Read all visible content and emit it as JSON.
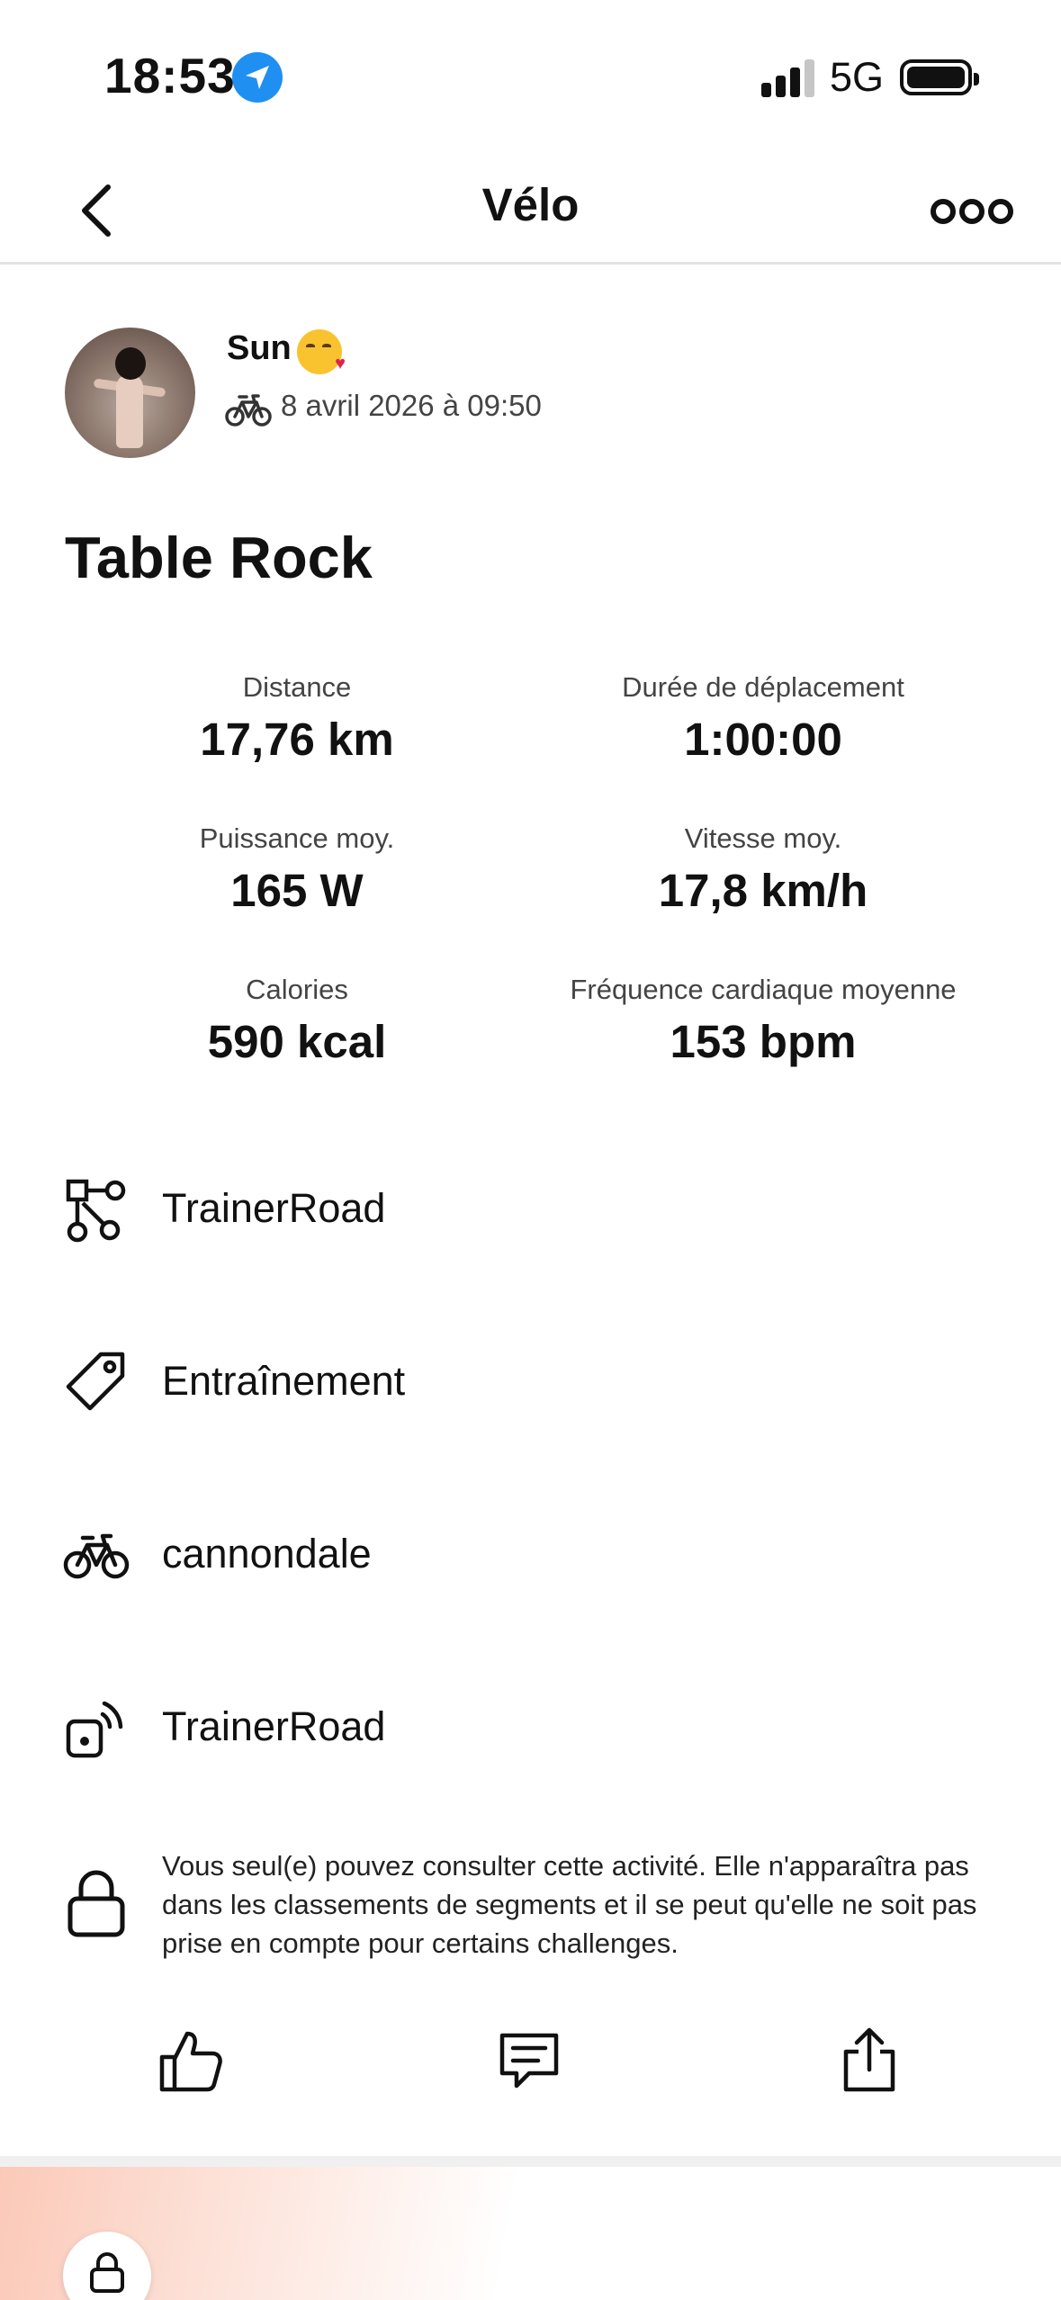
{
  "status_bar": {
    "time": "18:53",
    "network": "5G",
    "icons": [
      "location-arrow-icon",
      "signal-icon",
      "battery-icon"
    ]
  },
  "nav": {
    "title": "Vélo",
    "back_icon": "chevron-left-icon",
    "more_icon": "more-dots-icon"
  },
  "activity": {
    "user_name": "Sun",
    "user_emoji": "kissing-face-emoji",
    "sport_icon": "bike-icon",
    "datetime": "8 avril 2026 à 09:50",
    "title": "Table Rock"
  },
  "stats": [
    {
      "label": "Distance",
      "value": "17,76 km"
    },
    {
      "label": "Durée de déplacement",
      "value": "1:00:00"
    },
    {
      "label": "Puissance moy.",
      "value": "165 W"
    },
    {
      "label": "Vitesse moy.",
      "value": "17,8 km/h"
    },
    {
      "label": "Calories",
      "value": "590 kcal"
    },
    {
      "label": "Fréquence cardiaque moyenne",
      "value": "153 bpm"
    }
  ],
  "details": [
    {
      "icon": "workout-flow-icon",
      "label": "TrainerRoad"
    },
    {
      "icon": "tag-icon",
      "label": "Entraînement"
    },
    {
      "icon": "bike-icon",
      "label": "cannondale"
    },
    {
      "icon": "device-sync-icon",
      "label": "TrainerRoad"
    }
  ],
  "privacy": {
    "icon": "lock-icon",
    "text": "Vous seul(e) pouvez consulter cette activité. Elle n'apparaîtra pas dans les classements de segments et il se peut qu'elle ne soit pas prise en compte pour certains challenges."
  },
  "actions": [
    {
      "icon": "thumbs-up-icon"
    },
    {
      "icon": "comment-icon"
    },
    {
      "icon": "share-icon"
    }
  ],
  "colors": {
    "location_badge": "#1f8ff2",
    "card_gradient": "#fbc9b8"
  }
}
